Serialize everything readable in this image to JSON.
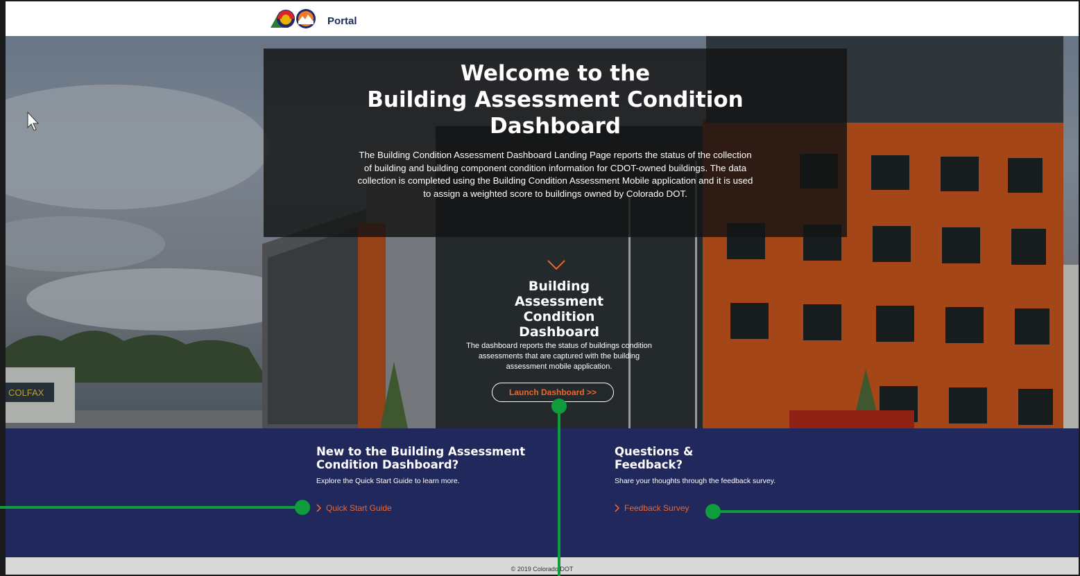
{
  "header": {
    "portal_label": "Portal",
    "logo_icon": "colorado-dot-logo-icon"
  },
  "hero": {
    "welcome_line1": "Welcome to the",
    "welcome_line2": "Building Assessment Condition",
    "welcome_line3": "Dashboard",
    "description": "The Building Condition Assessment Dashboard Landing Page reports the status of the collection of building and building component condition information for CDOT-owned buildings. The data collection is completed using the Building Condition Assessment Mobile application and it is used to assign a weighted score to buildings owned by Colorado DOT.",
    "dashboard_card": {
      "title_line1": "Building",
      "title_line2": "Assessment",
      "title_line3": "Condition",
      "title_line4": "Dashboard",
      "description": "The dashboard reports the status of buildings condition assessments that are captured with the building assessment mobile application.",
      "launch_label": "Launch Dashboard >>"
    },
    "street_sign": "COLFAX"
  },
  "info": {
    "new_user": {
      "heading_line1": "New to the Building Assessment",
      "heading_line2": "Condition Dashboard?",
      "text": "Explore the Quick Start Guide to learn more.",
      "link_label": "Quick Start Guide"
    },
    "feedback": {
      "heading_line1": "Questions &",
      "heading_line2": "Feedback?",
      "text": "Share your thoughts through the feedback survey.",
      "link_label": "Feedback Survey"
    }
  },
  "footer": {
    "copyright": "© 2019 Colorado DOT"
  },
  "colors": {
    "navy": "#21285c",
    "accent_orange": "#f0662a",
    "annotation_green": "#0e9c3c",
    "footer_gray": "#d9d9d9"
  }
}
